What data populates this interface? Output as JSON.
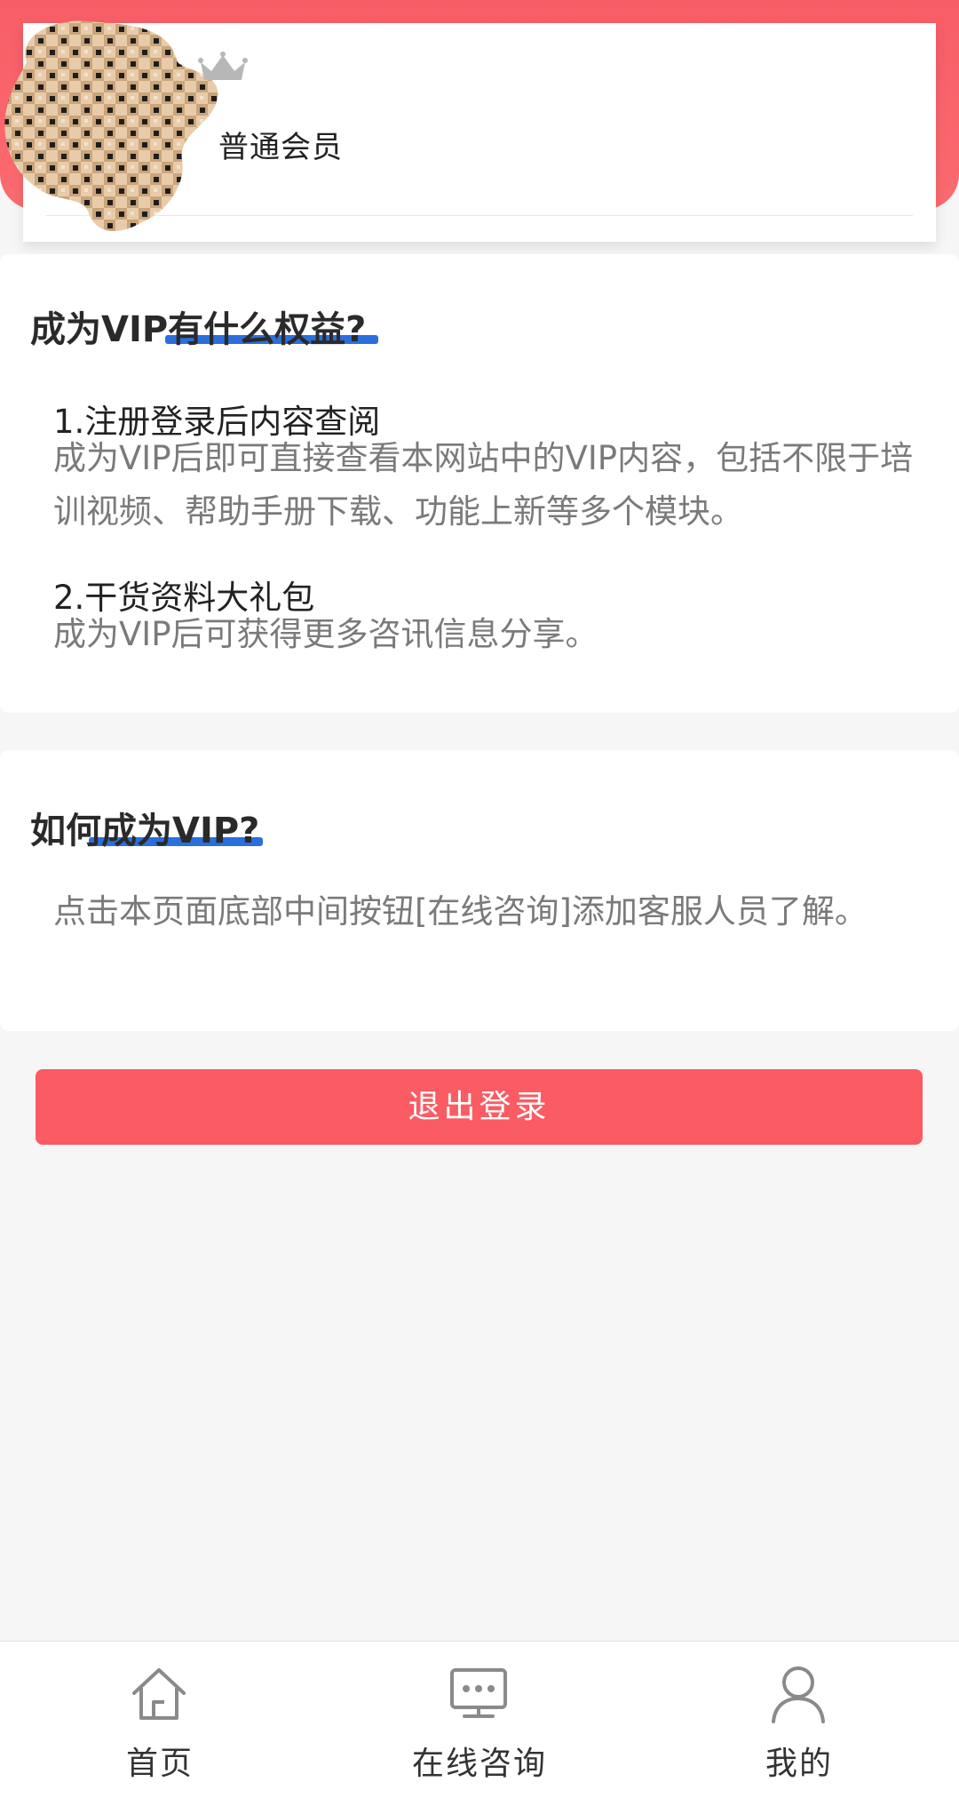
{
  "profile": {
    "member_level": "普通会员",
    "avatar_icon": "avatar-mosaic",
    "crown_icon": "crown-icon"
  },
  "benefits": {
    "title": "成为VIP有什么权益?",
    "items": [
      {
        "title": "1.注册登录后内容查阅",
        "desc": "成为VIP后即可直接查看本网站中的VIP内容，包括不限于培训视频、帮助手册下载、功能上新等多个模块。"
      },
      {
        "title": "2.干货资料大礼包",
        "desc": "成为VIP后可获得更多咨讯信息分享。"
      }
    ]
  },
  "howto": {
    "title": "如何成为VIP?",
    "desc": "点击本页面底部中间按钮[在线咨询]添加客服人员了解。"
  },
  "logout": {
    "label": "退出登录"
  },
  "nav": {
    "items": [
      {
        "label": "首页",
        "icon": "home-icon"
      },
      {
        "label": "在线咨询",
        "icon": "chat-icon"
      },
      {
        "label": "我的",
        "icon": "user-icon"
      }
    ]
  },
  "colors": {
    "brand_red": "#fb5b63",
    "title_underline": "#2a6fdc",
    "muted_text": "#7a7a7a"
  }
}
